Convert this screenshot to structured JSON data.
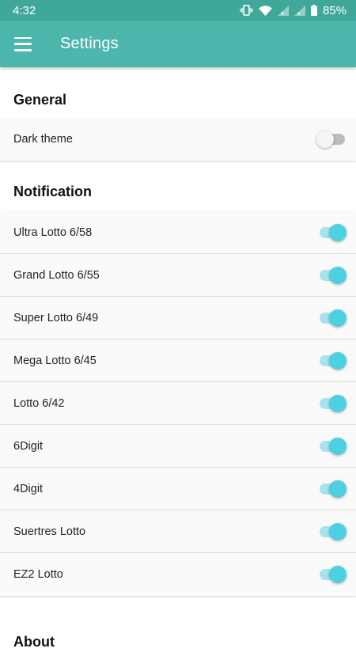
{
  "status_bar": {
    "time": "4:32",
    "battery": "85%"
  },
  "app_bar": {
    "title": "Settings",
    "menu_icon": "hamburger-menu-icon"
  },
  "colors": {
    "primary": "#4db6ac",
    "status_bar": "#40a89a",
    "accent": "#4dd0e1"
  },
  "general": {
    "title": "General",
    "items": [
      {
        "label": "Dark theme",
        "enabled": false
      }
    ]
  },
  "notification": {
    "title": "Notification",
    "items": [
      {
        "label": "Ultra Lotto 6/58",
        "enabled": true
      },
      {
        "label": "Grand Lotto 6/55",
        "enabled": true
      },
      {
        "label": "Super Lotto 6/49",
        "enabled": true
      },
      {
        "label": "Mega Lotto 6/45",
        "enabled": true
      },
      {
        "label": "Lotto 6/42",
        "enabled": true
      },
      {
        "label": "6Digit",
        "enabled": true
      },
      {
        "label": "4Digit",
        "enabled": true
      },
      {
        "label": "Suertres Lotto",
        "enabled": true
      },
      {
        "label": "EZ2 Lotto",
        "enabled": true
      }
    ]
  },
  "about": {
    "title": "About"
  }
}
